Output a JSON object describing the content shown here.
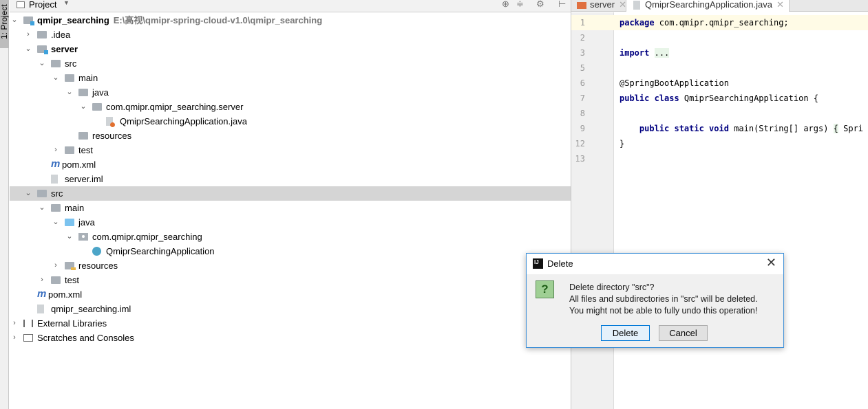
{
  "tool_strip": {
    "label": "1: Project"
  },
  "project_panel": {
    "title": "Project"
  },
  "tree": [
    {
      "label": "qmipr_searching",
      "path": "E:\\高视\\qmipr-spring-cloud-v1.0\\qmipr_searching",
      "level": 0,
      "arrow": "open",
      "icon": "module-folder-icon",
      "bold": true
    },
    {
      "label": ".idea",
      "level": 1,
      "arrow": "closed",
      "icon": "folder-icon"
    },
    {
      "label": "server",
      "level": 1,
      "arrow": "open",
      "icon": "module-folder-icon",
      "bold": true
    },
    {
      "label": "src",
      "level": 2,
      "arrow": "open",
      "icon": "folder-icon"
    },
    {
      "label": "main",
      "level": 3,
      "arrow": "open",
      "icon": "folder-icon"
    },
    {
      "label": "java",
      "level": 4,
      "arrow": "open",
      "icon": "folder-icon"
    },
    {
      "label": "com.qmipr.qmipr_searching.server",
      "level": 5,
      "arrow": "open",
      "icon": "folder-icon"
    },
    {
      "label": "QmiprSearchingApplication.java",
      "level": 6,
      "arrow": "",
      "icon": "java-file-icon"
    },
    {
      "label": "resources",
      "level": 4,
      "arrow": "",
      "icon": "folder-icon"
    },
    {
      "label": "test",
      "level": 3,
      "arrow": "closed",
      "icon": "folder-icon"
    },
    {
      "label": "pom.xml",
      "level": 2,
      "arrow": "",
      "icon": "maven-icon"
    },
    {
      "label": "server.iml",
      "level": 2,
      "arrow": "",
      "icon": "iml-file-icon"
    },
    {
      "label": "src",
      "level": 1,
      "arrow": "open",
      "icon": "folder-icon",
      "selected": true
    },
    {
      "label": "main",
      "level": 2,
      "arrow": "open",
      "icon": "folder-icon"
    },
    {
      "label": "java",
      "level": 3,
      "arrow": "open",
      "icon": "source-folder-icon"
    },
    {
      "label": "com.qmipr.qmipr_searching",
      "level": 4,
      "arrow": "open",
      "icon": "package-icon"
    },
    {
      "label": "QmiprSearchingApplication",
      "level": 5,
      "arrow": "",
      "icon": "spring-class-icon"
    },
    {
      "label": "resources",
      "level": 3,
      "arrow": "closed",
      "icon": "resources-folder-icon"
    },
    {
      "label": "test",
      "level": 2,
      "arrow": "closed",
      "icon": "folder-icon"
    },
    {
      "label": "pom.xml",
      "level": 1,
      "arrow": "",
      "icon": "maven-icon"
    },
    {
      "label": "qmipr_searching.iml",
      "level": 1,
      "arrow": "",
      "icon": "iml-file-icon"
    },
    {
      "label": "External Libraries",
      "level": 0,
      "arrow": "closed",
      "icon": "libraries-icon"
    },
    {
      "label": "Scratches and Consoles",
      "level": 0,
      "arrow": "closed",
      "icon": "scratches-icon"
    }
  ],
  "editor": {
    "tabs": [
      {
        "label": "server",
        "active": false
      },
      {
        "label": "QmiprSearchingApplication.java",
        "active": true
      }
    ],
    "lines": [
      {
        "n": "1",
        "html": "<span class='kw'>package</span> com.qmipr.qmipr_searching;",
        "current": true
      },
      {
        "n": "2",
        "html": ""
      },
      {
        "n": "3",
        "html": "<span class='kw'>import</span> <span class='fold'>...</span>"
      },
      {
        "n": "5",
        "html": ""
      },
      {
        "n": "6",
        "html": "@SpringBootApplication"
      },
      {
        "n": "7",
        "html": "<span class='kw'>public class</span> QmiprSearchingApplication {"
      },
      {
        "n": "8",
        "html": ""
      },
      {
        "n": "9",
        "html": "    <span class='kw'>public static void</span> main(String[] args) <span class='fold'>{</span> Spri"
      },
      {
        "n": "12",
        "html": "}"
      },
      {
        "n": "13",
        "html": ""
      }
    ]
  },
  "dialog": {
    "title": "Delete",
    "line1": "Delete directory \"src\"?",
    "line2": "All files and subdirectories in \"src\" will be deleted.",
    "line3": "You might not be able to fully undo this operation!",
    "delete_label": "Delete",
    "cancel_label": "Cancel",
    "question_glyph": "?",
    "logo_text": "IJ"
  }
}
